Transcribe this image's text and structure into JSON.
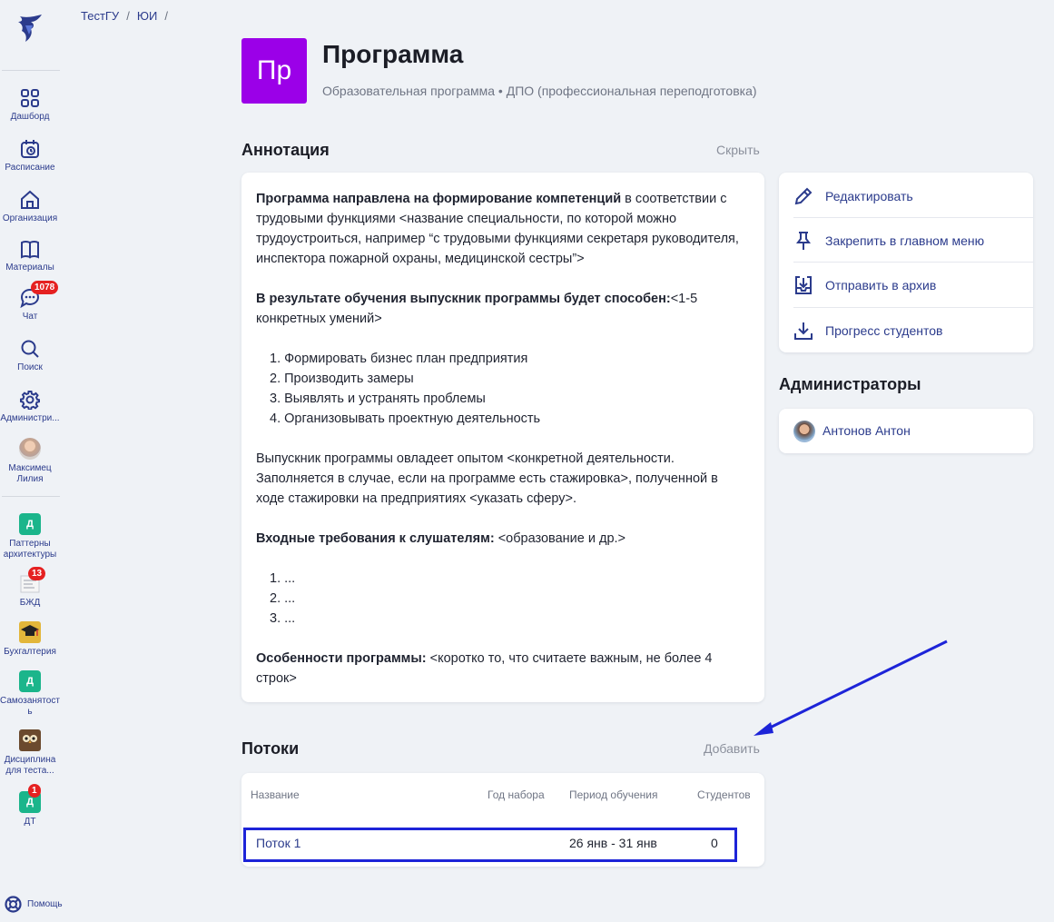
{
  "breadcrumb": [
    "ТестГУ",
    "ЮИ"
  ],
  "breadcrumb_sep": "/",
  "sidebar": {
    "items": [
      {
        "label": "Дашборд",
        "icon": "dashboard-icon"
      },
      {
        "label": "Расписание",
        "icon": "calendar-icon"
      },
      {
        "label": "Организация",
        "icon": "organization-icon"
      },
      {
        "label": "Материалы",
        "icon": "book-icon"
      },
      {
        "label": "Чат",
        "icon": "chat-icon",
        "badge": "1078"
      },
      {
        "label": "Поиск",
        "icon": "search-icon"
      },
      {
        "label": "Администри...",
        "icon": "gear-icon"
      }
    ],
    "user": {
      "name": "Максимец Лилия"
    },
    "courses": [
      {
        "tile": "Д",
        "label": "Паттерны архитектуры"
      },
      {
        "label": "БЖД",
        "badge": "13"
      },
      {
        "label": "Бухгалтерия"
      },
      {
        "tile": "Д",
        "label": "Самозанятость"
      },
      {
        "label": "Дисциплина для теста..."
      },
      {
        "tile": "Д",
        "label": "ДТ",
        "badge": "1"
      }
    ],
    "help": "Помощь"
  },
  "header": {
    "tile": "Пр",
    "title": "Программа",
    "subtitle": "Образовательная программа • ДПО (профессиональная переподготовка)"
  },
  "annotation": {
    "heading": "Аннотация",
    "hide_label": "Скрыть",
    "p1_bold": "Программа направлена на формирование компетенций",
    "p1_rest": " в соответствии с трудовыми функциями <название специальности, по которой можно трудоустроиться, например “с трудовыми функциями секретаря руководителя, инспектора пожарной охраны, медицинской сестры”>",
    "p2_bold": "В результате обучения выпускник программы будет способен:",
    "p2_rest": "<1-5 конкретных умений>",
    "list1": [
      "1. Формировать бизнес план предприятия",
      "2. Производить замеры",
      "3. Выявлять и устранять проблемы",
      "4. Организовывать проектную деятельность"
    ],
    "p3": "Выпускник программы овладеет опытом <конкретной деятельности. Заполняется в случае, если на программе есть стажировка>, полученной в ходе стажировки на предприятиях <указать сферу>.",
    "p4_bold": "Входные требования к слушателям:",
    "p4_rest": " <образование и др.>",
    "list2": [
      "1. ...",
      "2. ...",
      "3. ..."
    ],
    "p5_bold": "Особенности программы:",
    "p5_rest": " <коротко то, что считаете важным, не более 4 строк>"
  },
  "actions": [
    {
      "label": "Редактировать",
      "icon": "pencil-icon"
    },
    {
      "label": "Закрепить в главном меню",
      "icon": "pin-icon"
    },
    {
      "label": "Отправить в архив",
      "icon": "archive-icon"
    },
    {
      "label": "Прогресс студентов",
      "icon": "download-icon"
    }
  ],
  "admins": {
    "heading": "Администраторы",
    "items": [
      {
        "name": "Антонов Антон"
      }
    ]
  },
  "streams": {
    "heading": "Потоки",
    "add_label": "Добавить",
    "columns": [
      "Название",
      "Год набора",
      "Период обучения",
      "Студентов"
    ],
    "rows": [
      {
        "name": "Поток 1",
        "year": "",
        "period": "26 янв - 31 янв",
        "students": "0"
      }
    ]
  },
  "colors": {
    "accent": "#2b3b8c",
    "tile": "#9b00e8",
    "highlight": "#1d24d8",
    "badge": "#e52121",
    "course_tile": "#1bb58b"
  }
}
